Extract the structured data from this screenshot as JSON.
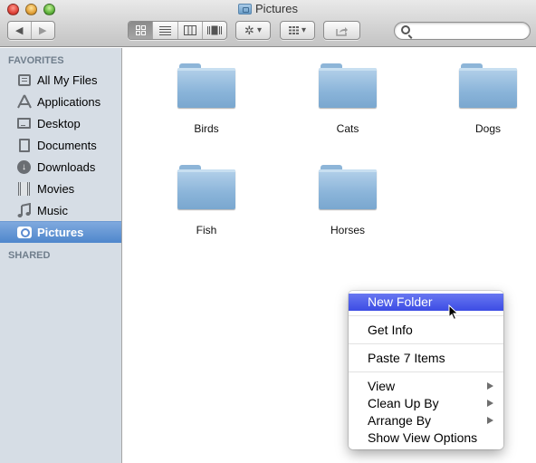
{
  "window": {
    "title": "Pictures",
    "title_icon": "pictures-folder-icon"
  },
  "toolbar": {
    "back_icon": "◀",
    "forward_icon": "▶",
    "view_buttons": [
      {
        "name": "icon-view",
        "glyph": "⊞",
        "active": true
      },
      {
        "name": "list-view",
        "glyph": "☰",
        "active": false
      },
      {
        "name": "column-view",
        "glyph": "▥",
        "active": false
      },
      {
        "name": "cover-flow-view",
        "glyph": "▮",
        "active": false
      }
    ],
    "action_glyph": "✲",
    "dropdown_glyph": "▾",
    "arrange_glyph": "▦",
    "share_glyph": "⇪",
    "search_placeholder": ""
  },
  "sidebar": {
    "favorites_header": "FAVORITES",
    "shared_header": "SHARED",
    "items": [
      {
        "label": "All My Files",
        "icon": "all-my-files-icon"
      },
      {
        "label": "Applications",
        "icon": "applications-icon"
      },
      {
        "label": "Desktop",
        "icon": "desktop-icon"
      },
      {
        "label": "Documents",
        "icon": "documents-icon"
      },
      {
        "label": "Downloads",
        "icon": "downloads-icon"
      },
      {
        "label": "Movies",
        "icon": "movies-icon"
      },
      {
        "label": "Music",
        "icon": "music-icon"
      },
      {
        "label": "Pictures",
        "icon": "pictures-icon",
        "selected": true
      }
    ]
  },
  "content": {
    "folders": [
      {
        "name": "Birds"
      },
      {
        "name": "Cats"
      },
      {
        "name": "Dogs"
      },
      {
        "name": "Fish"
      },
      {
        "name": "Horses"
      }
    ]
  },
  "context_menu": {
    "items": [
      {
        "label": "New Folder",
        "highlighted": true
      },
      {
        "label": "Get Info"
      },
      {
        "label": "Paste 7 Items"
      },
      {
        "label": "View",
        "submenu": true
      },
      {
        "label": "Clean Up By",
        "submenu": true
      },
      {
        "label": "Arrange By",
        "submenu": true
      },
      {
        "label": "Show View Options"
      }
    ]
  },
  "colors": {
    "selection_blue": "#5b8fd0",
    "menu_highlight": "#4a5ae8",
    "sidebar_bg": "#d6dde5",
    "folder_blue": "#8ab4d9"
  }
}
